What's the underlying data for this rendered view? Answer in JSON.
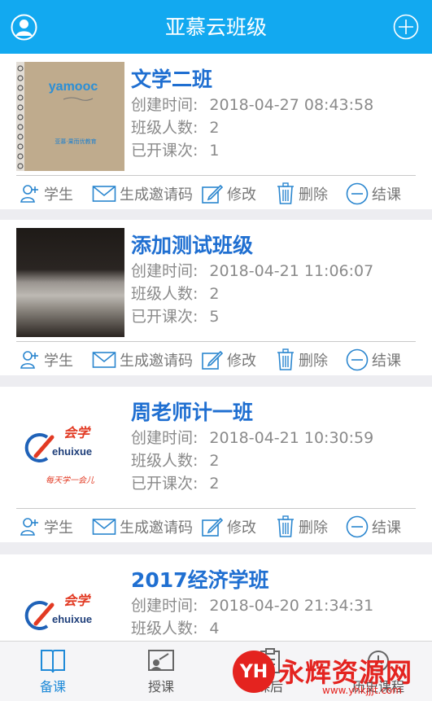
{
  "header": {
    "title": "亚慕云班级",
    "avatar_icon": "user-avatar-icon",
    "add_icon": "plus-circle-icon"
  },
  "labels": {
    "created": "创建时间:",
    "count": "班级人数:",
    "sessions": "已开课次:"
  },
  "actions": {
    "student": "学生",
    "invite": "生成邀请码",
    "edit": "修改",
    "delete": "删除",
    "finish": "结课"
  },
  "classes": [
    {
      "name": "文学二班",
      "created": "2018-04-27 08:43:58",
      "count": "2",
      "sessions": "1",
      "thumb": "notebook-photo"
    },
    {
      "name": "添加测试班级",
      "created": "2018-04-21 11:06:07",
      "count": "2",
      "sessions": "5",
      "thumb": "dark-photo"
    },
    {
      "name": "周老师计一班",
      "created": "2018-04-21 10:30:59",
      "count": "2",
      "sessions": "2",
      "thumb": "ehuixue-logo"
    },
    {
      "name": "2017经济学班",
      "created": "2018-04-20 21:34:31",
      "count": "4",
      "sessions": "",
      "thumb": "ehuixue-logo"
    }
  ],
  "logo_text": {
    "brand": "会学",
    "latin": "ehuixue",
    "slogan": "每天学一会儿"
  },
  "notebook_text": {
    "brand": "yamooc",
    "small": "亚慕·果而优教育"
  },
  "tabs": [
    {
      "label": "备课",
      "icon": "book-icon",
      "active": true
    },
    {
      "label": "授课",
      "icon": "teach-icon",
      "active": false
    },
    {
      "label": "课后",
      "icon": "clipboard-icon",
      "active": false
    },
    {
      "label": "历史课程",
      "icon": "history-icon",
      "active": false
    }
  ],
  "watermark": {
    "mark": "YH",
    "text": "永辉资源网",
    "url": "www.yhkjjjt.com"
  },
  "colors": {
    "header": "#12a9f0",
    "title_blue": "#1f6fd1",
    "action_blue": "#2a86cf"
  }
}
